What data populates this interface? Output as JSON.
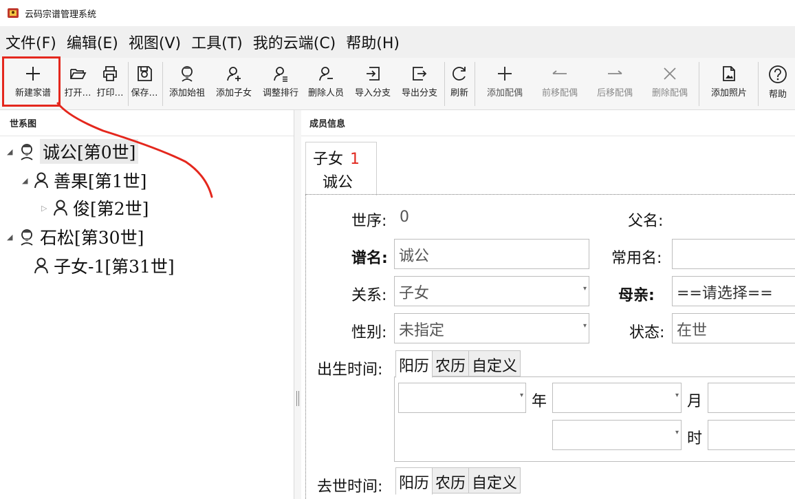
{
  "window": {
    "title": "云码宗谱管理系统"
  },
  "menu": [
    "文件(F)",
    "编辑(E)",
    "视图(V)",
    "工具(T)",
    "我的云端(C)",
    "帮助(H)"
  ],
  "toolbar": {
    "new_genealogy": "新建家谱",
    "open": "打开…",
    "print": "打印…",
    "save": "保存…",
    "add_ancestor": "添加始祖",
    "add_child": "添加子女",
    "reorder": "调整排行",
    "delete_person": "删除人员",
    "import_branch": "导入分支",
    "export_branch": "导出分支",
    "refresh": "刷新",
    "add_spouse": "添加配偶",
    "move_spouse_up": "前移配偶",
    "move_spouse_down": "后移配偶",
    "delete_spouse": "删除配偶",
    "add_photo": "添加照片",
    "help": "帮助"
  },
  "left_pane": {
    "header": "世系图",
    "tree": [
      {
        "label": "诚公[第0世]",
        "icon": "ancestor-portrait-icon",
        "expanded": true,
        "selected": true
      },
      {
        "label": "善果[第1世]",
        "icon": "person-icon",
        "expanded": true
      },
      {
        "label": "俊[第2世]",
        "icon": "person-icon",
        "expanded": false
      },
      {
        "label": "石松[第30世]",
        "icon": "ancestor-portrait-icon",
        "expanded": true
      },
      {
        "label": "子女-1[第31世]",
        "icon": "person-icon"
      }
    ]
  },
  "right_pane": {
    "header": "成员信息",
    "tab": {
      "relation": "子女",
      "index": "1",
      "name": "诚公"
    },
    "form": {
      "generation_label": "世序:",
      "generation_value": "0",
      "father_label": "父名:",
      "father_value": "",
      "genealogy_name_label": "谱名:",
      "genealogy_name_value": "诚公",
      "common_name_label": "常用名:",
      "common_name_value": "",
      "relation_label": "关系:",
      "relation_value": "子女",
      "mother_label": "母亲:",
      "mother_value": "==请选择==",
      "gender_label": "性别:",
      "gender_value": "未指定",
      "status_label": "状态:",
      "status_value": "在世",
      "birth_label": "出生时间:",
      "death_label": "去世时间:",
      "calendar_tabs": [
        "阳历",
        "农历",
        "自定义"
      ],
      "year_unit": "年",
      "month_unit": "月",
      "hour_unit": "时"
    }
  },
  "colors": {
    "highlight": "#e4271d",
    "tab_number": "#e0281e"
  }
}
